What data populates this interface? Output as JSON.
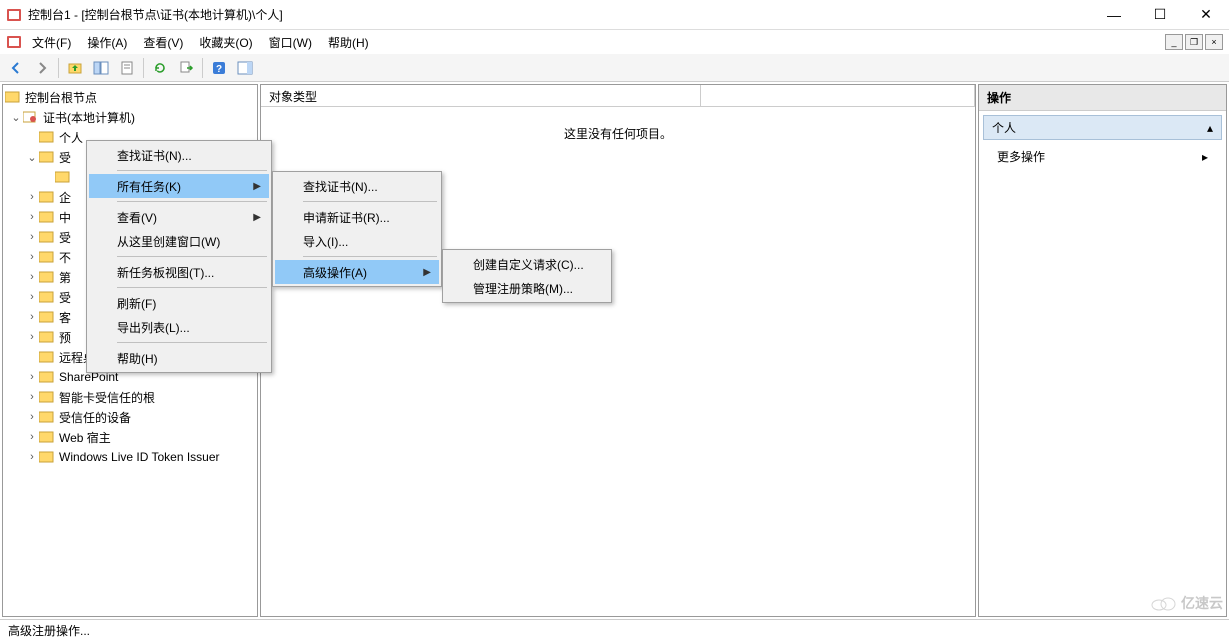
{
  "window": {
    "title": "控制台1 - [控制台根节点\\证书(本地计算机)\\个人]",
    "buttons": {
      "min": "—",
      "max": "☐",
      "close": "✕"
    },
    "mdi": {
      "min": "_",
      "restore": "❐",
      "close": "×"
    }
  },
  "menubar": [
    "文件(F)",
    "操作(A)",
    "查看(V)",
    "收藏夹(O)",
    "窗口(W)",
    "帮助(H)"
  ],
  "toolbar": {
    "back": "back",
    "forward": "forward",
    "up": "up",
    "show_tree": "tree",
    "props": "properties",
    "delete": "delete",
    "refresh": "refresh",
    "export": "export",
    "help": "help",
    "tile": "tile"
  },
  "tree": {
    "root": "控制台根节点",
    "cert_root": "证书(本地计算机)",
    "personal": "个人",
    "trusted_root": "受",
    "nodes": [
      {
        "label": "企",
        "tw": "›"
      },
      {
        "label": "中",
        "tw": "›"
      },
      {
        "label": "受",
        "tw": "›"
      },
      {
        "label": "不",
        "tw": "›"
      },
      {
        "label": "第",
        "tw": "›"
      },
      {
        "label": "受",
        "tw": "›"
      },
      {
        "label": "客",
        "tw": "›"
      },
      {
        "label": "预",
        "tw": "›"
      }
    ],
    "rest": [
      {
        "label": "远程桌面",
        "tw": ""
      },
      {
        "label": "SharePoint",
        "tw": "›"
      },
      {
        "label": "智能卡受信任的根",
        "tw": "›"
      },
      {
        "label": "受信任的设备",
        "tw": "›"
      },
      {
        "label": "Web 宿主",
        "tw": "›"
      },
      {
        "label": "Windows Live ID Token Issuer",
        "tw": "›"
      }
    ]
  },
  "list": {
    "col_object_type": "对象类型",
    "empty": "这里没有任何项目。"
  },
  "actions": {
    "title": "操作",
    "section": "个人",
    "more": "更多操作"
  },
  "context1": {
    "find": "查找证书(N)...",
    "all_tasks": "所有任务(K)",
    "view": "查看(V)",
    "new_window": "从这里创建窗口(W)",
    "new_taskpad": "新任务板视图(T)...",
    "refresh": "刷新(F)",
    "export_list": "导出列表(L)...",
    "help": "帮助(H)"
  },
  "context2": {
    "find": "查找证书(N)...",
    "request": "申请新证书(R)...",
    "import": "导入(I)...",
    "advanced": "高级操作(A)"
  },
  "context3": {
    "custom_request": "创建自定义请求(C)...",
    "manage_policy": "管理注册策略(M)..."
  },
  "status": "高级注册操作...",
  "watermark": "亿速云"
}
